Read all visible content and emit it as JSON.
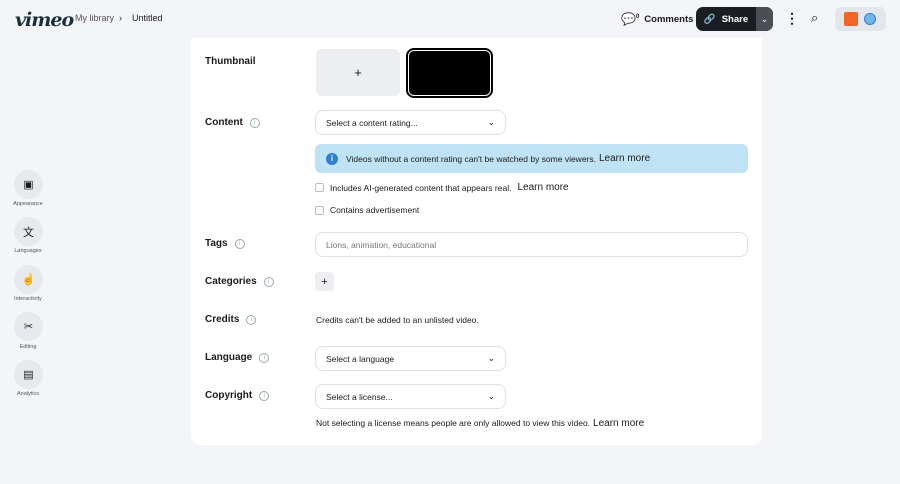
{
  "header": {
    "logo": "vimeo",
    "breadcrumb": [
      "My library",
      "Untitled"
    ],
    "comments_label": "Comments",
    "comments_count": "0",
    "share_label": "Share"
  },
  "sidebar": [
    {
      "label": "Appearance",
      "icon": "play-square-icon"
    },
    {
      "label": "Languages",
      "icon": "translate-icon"
    },
    {
      "label": "Interactivity",
      "icon": "tap-icon"
    },
    {
      "label": "Editing",
      "icon": "scissors-icon"
    },
    {
      "label": "Analytics",
      "icon": "chart-icon"
    }
  ],
  "form": {
    "thumbnail_label": "Thumbnail",
    "add_thumbnail": "+",
    "content_label": "Content",
    "content_rating_placeholder": "Select a content rating...",
    "content_notice": "Videos without a content rating can't be watched by some viewers.",
    "learn_more": "Learn more",
    "ai_checkbox": "Includes AI-generated content that appears real.",
    "ad_checkbox": "Contains advertisement",
    "tags_label": "Tags",
    "tags_placeholder": "Lions, animation, educational",
    "categories_label": "Categories",
    "add_category": "+",
    "credits_label": "Credits",
    "credits_note": "Credits can't be added to an unlisted video.",
    "language_label": "Language",
    "language_placeholder": "Select a language",
    "copyright_label": "Copyright",
    "license_placeholder": "Select a license...",
    "license_note": "Not selecting a license means people are only allowed to view this video."
  },
  "colors": {
    "notice_bg": "#bfe3f5",
    "info_blue": "#2f7fd6",
    "share_bg": "#1a1d22"
  }
}
